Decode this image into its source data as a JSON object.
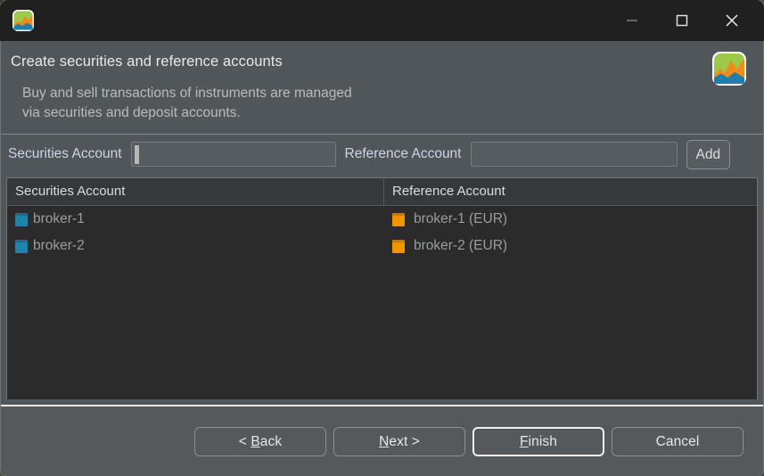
{
  "window": {
    "app_icon": "chart-app-icon",
    "controls": {
      "minimize": "minimize-icon",
      "maximize": "maximize-icon",
      "close": "close-icon"
    }
  },
  "header": {
    "title": "Create securities and reference accounts",
    "description": "Buy and sell transactions of instruments are managed\nvia securities and deposit accounts.",
    "icon": "chart-app-icon"
  },
  "form": {
    "securities_label": "Securities Account",
    "securities_value": "",
    "securities_placeholder": "",
    "reference_label": "Reference Account",
    "reference_value": "",
    "reference_placeholder": "",
    "add_label": "Add"
  },
  "table": {
    "columns": [
      "Securities Account",
      "Reference Account"
    ],
    "rows": [
      {
        "securities_account": "broker-1",
        "reference_account": "broker-1 (EUR)"
      },
      {
        "securities_account": "broker-2",
        "reference_account": "broker-2 (EUR)"
      }
    ]
  },
  "footer": {
    "back": {
      "prefix": "< ",
      "mnemonic": "B",
      "suffix": "ack"
    },
    "next": {
      "prefix": "",
      "mnemonic": "N",
      "suffix": "ext >"
    },
    "finish": {
      "prefix": "",
      "mnemonic": "F",
      "suffix": "inish"
    },
    "cancel": {
      "prefix": "",
      "mnemonic": "",
      "suffix": "Cancel"
    }
  },
  "colors": {
    "titlebar": "#202020",
    "dialog": "#50565a",
    "table_bg": "#2b2b2b",
    "table_header_bg": "#35393b",
    "footer_bg": "#55595c",
    "securities_icon": "#1f84ab",
    "reference_icon": "#f29400",
    "label_text": "#cdd4e4",
    "row_text": "#9a9d9f",
    "separator": "#e7e7e7"
  }
}
